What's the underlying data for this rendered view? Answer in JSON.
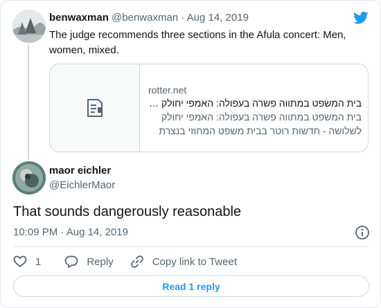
{
  "tweet1": {
    "display_name": "benwaxman",
    "handle": "@benwaxman",
    "separator": "·",
    "date": "Aug 14, 2019",
    "text": "The judge recommends three sections in the Afula concert: Men, women, mixed.",
    "avatar_icon": "profile-photo",
    "link_card": {
      "domain": "rotter.net",
      "title": "בית המשפט במתווה פשרה בעפולה: האמפי יחולק …",
      "description": "בית המשפט במתווה פשרה בעפולה: האמפי יחולק לשלושה - חדשות רוטר בבית משפט המחוזי בנצרת",
      "thumb_icon": "document-icon"
    }
  },
  "tweet2": {
    "display_name": "maor eichler",
    "handle": "@EichlerMaor",
    "text": "That sounds dangerously reasonable",
    "time": "10:09 PM",
    "separator": "·",
    "date": "Aug 14, 2019",
    "avatar_icon": "profile-photo"
  },
  "actions": {
    "like_count": "1",
    "reply_label": "Reply",
    "copy_link_label": "Copy link to Tweet"
  },
  "read_replies_label": "Read 1 reply",
  "colors": {
    "accent": "#1d9bf0",
    "muted_text": "#536471",
    "border": "#cfd9de"
  }
}
